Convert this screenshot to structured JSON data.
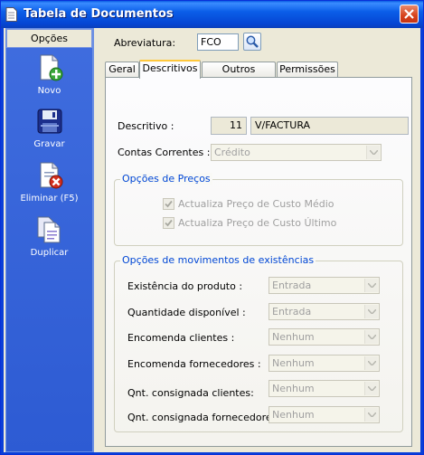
{
  "window": {
    "title": "Tabela de Documentos"
  },
  "sidebar": {
    "header": "Opções",
    "buttons": [
      {
        "label": "Novo",
        "icon": "new-document-icon"
      },
      {
        "label": "Gravar",
        "icon": "save-disk-icon"
      },
      {
        "label": "Eliminar (F5)",
        "icon": "delete-document-icon"
      },
      {
        "label": "Duplicar",
        "icon": "duplicate-document-icon"
      }
    ]
  },
  "form": {
    "abreviatura_label": "Abreviatura:",
    "abreviatura_value": "FCO"
  },
  "tabs": [
    "Geral",
    "Descritivos",
    "Outros Campos",
    "Permissões"
  ],
  "active_tab": "Descritivos",
  "descritivos": {
    "descritivo_label": "Descritivo :",
    "descritivo_number": "11",
    "descritivo_text": "V/FACTURA",
    "contas_label": "Contas Correntes :",
    "contas_value": "Crédito",
    "precos_title": "Opções de  Preços",
    "checkbox_custo_medio": "Actualiza Preço de Custo Médio",
    "checkbox_custo_ultimo": "Actualiza Preço de Custo Último",
    "existencias_title": "Opções de movimentos de existências",
    "rows": [
      {
        "label": "Existência do produto :",
        "value": "Entrada"
      },
      {
        "label": "Quantidade disponível :",
        "value": "Entrada"
      },
      {
        "label": "Encomenda clientes :",
        "value": "Nenhum"
      },
      {
        "label": "Encomenda fornecedores :",
        "value": "Nenhum"
      },
      {
        "label": "Qnt. consignada clientes:",
        "value": "Nenhum"
      },
      {
        "label": "Qnt. consignada fornecedores:",
        "value": "Nenhum"
      }
    ]
  },
  "colors": {
    "title_bar": "#0545d3",
    "sidebar": "#2d5bd3",
    "group_title": "#0046d5",
    "close_button": "#d6421b"
  }
}
